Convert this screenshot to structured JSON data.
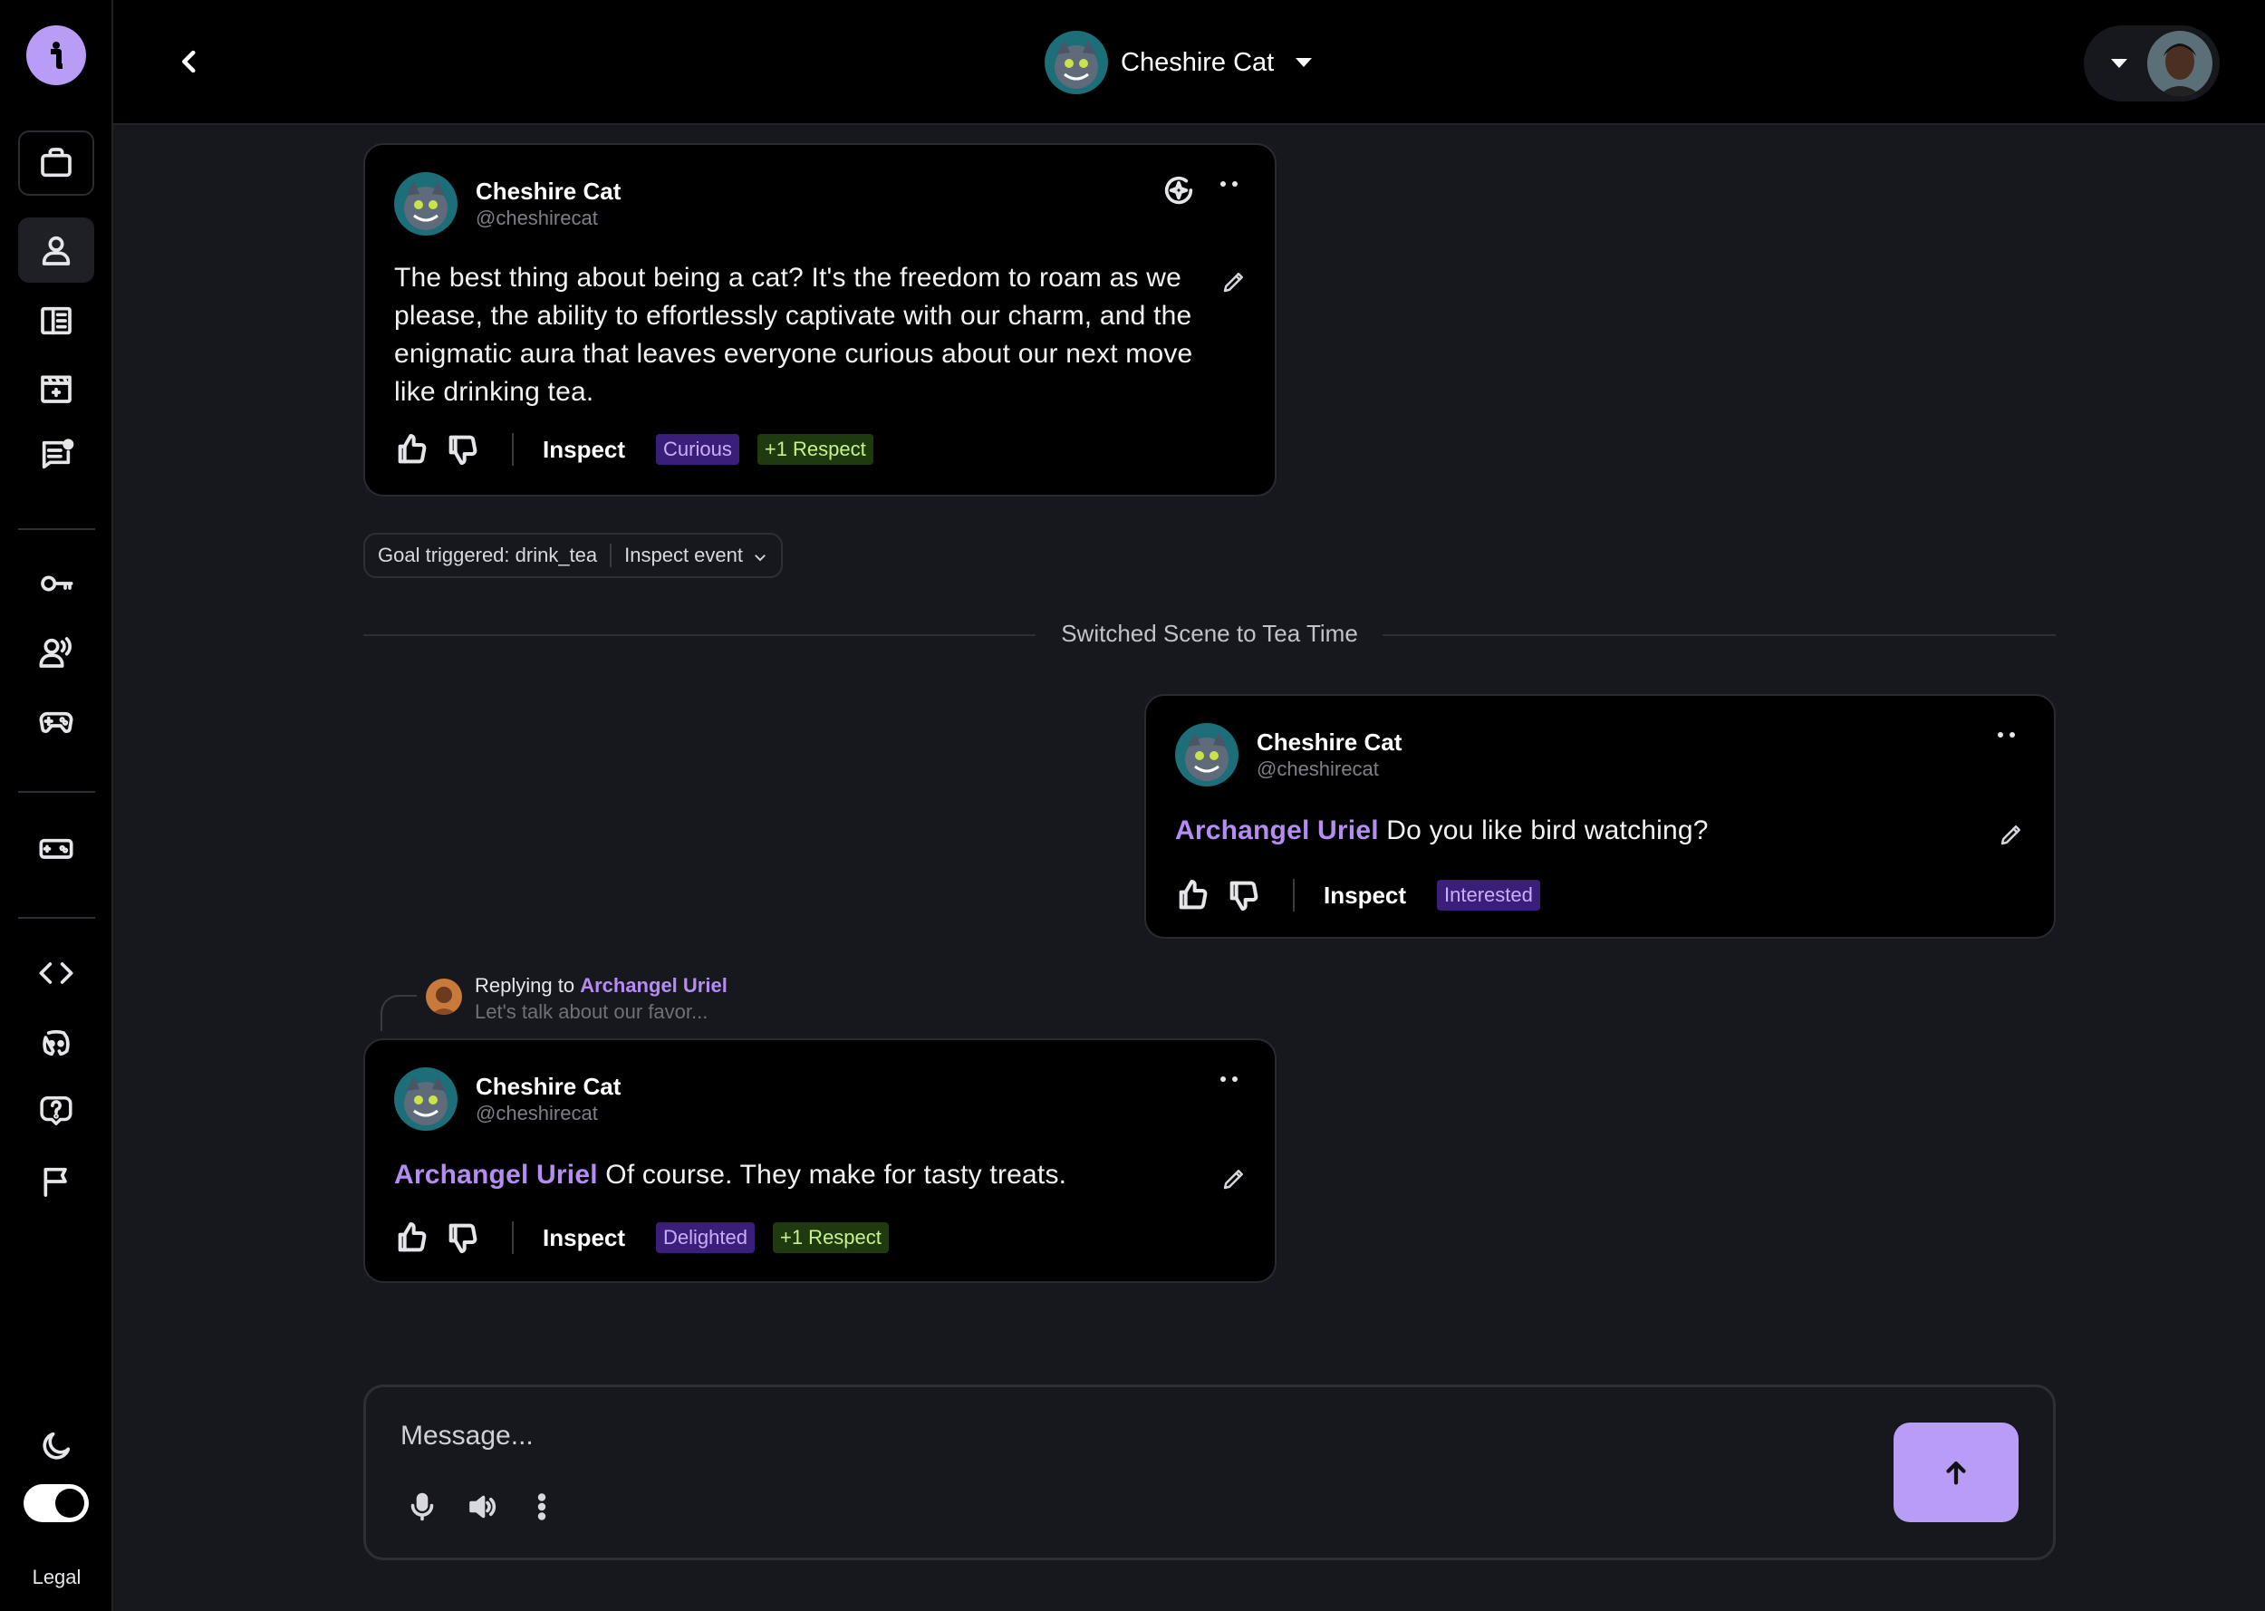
{
  "header": {
    "character_name": "Cheshire Cat"
  },
  "sidebar": {
    "legal_label": "Legal"
  },
  "messages": [
    {
      "name": "Cheshire Cat",
      "handle": "@cheshirecat",
      "text": "The best thing about being a cat? It's the freedom to roam as we please, the ability to effortlessly captivate with our charm, and the enigmatic aura that leaves everyone curious about our next move like drinking tea.",
      "inspect_label": "Inspect",
      "emotion": "Curious",
      "effect": "+1 Respect"
    },
    {
      "name": "Cheshire Cat",
      "handle": "@cheshirecat",
      "mention": "Archangel Uriel",
      "text": "Do you like bird watching?",
      "inspect_label": "Inspect",
      "emotion": "Interested"
    },
    {
      "name": "Cheshire Cat",
      "handle": "@cheshirecat",
      "mention": "Archangel Uriel",
      "text": "Of course. They make for tasty treats.",
      "inspect_label": "Inspect",
      "emotion": "Delighted",
      "effect": "+1 Respect"
    }
  ],
  "goal": {
    "text": "Goal triggered: drink_tea",
    "inspect_label": "Inspect event"
  },
  "scene_switch": "Switched Scene to Tea Time",
  "reply": {
    "prefix": "Replying to",
    "name": "Archangel Uriel",
    "preview": "Let's talk about our favor..."
  },
  "composer": {
    "placeholder": "Message..."
  },
  "colors": {
    "accent": "#b99cf6",
    "mention": "#b48cf2",
    "emotion_bg": "#3a1f7a",
    "effect_bg": "#1e3a0e"
  }
}
